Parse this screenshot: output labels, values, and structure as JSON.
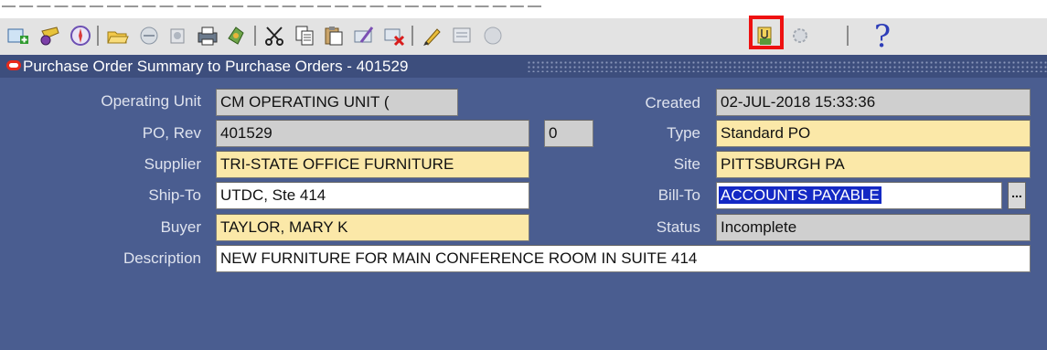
{
  "top_strip_text": "— — — — — — — — — — — — — — — — — — — — — — — — — — — — — — —",
  "toolbar": {
    "buttons": [
      {
        "name": "new-record-icon"
      },
      {
        "name": "find-icon"
      },
      {
        "name": "navigator-icon"
      },
      {
        "name": "open-folder-icon"
      },
      {
        "name": "save-icon"
      },
      {
        "name": "next-step-icon"
      },
      {
        "name": "print-icon"
      },
      {
        "name": "close-form-icon"
      },
      {
        "name": "cut-icon"
      },
      {
        "name": "copy-icon"
      },
      {
        "name": "paste-icon"
      },
      {
        "name": "clear-record-icon"
      },
      {
        "name": "delete-record-icon"
      },
      {
        "name": "edit-field-icon"
      },
      {
        "name": "zoom-icon"
      },
      {
        "name": "translations-icon"
      },
      {
        "name": "attachments-icon"
      },
      {
        "name": "folder-tools-icon"
      }
    ],
    "help_label": "?"
  },
  "window": {
    "title": "Purchase Order Summary to Purchase Orders - 401529"
  },
  "form": {
    "operating_unit_label": "Operating Unit",
    "operating_unit_value": "CM OPERATING UNIT (",
    "created_label": "Created",
    "created_value": "02-JUL-2018 15:33:36",
    "po_rev_label": "PO, Rev",
    "po_value": "401529",
    "rev_value": "0",
    "type_label": "Type",
    "type_value": "Standard PO",
    "supplier_label": "Supplier",
    "supplier_value": "TRI-STATE OFFICE FURNITURE",
    "site_label": "Site",
    "site_value": "PITTSBURGH PA",
    "ship_to_label": "Ship-To",
    "ship_to_value": "UTDC, Ste 414",
    "bill_to_label": "Bill-To",
    "bill_to_value": "ACCOUNTS PAYABLE",
    "bill_to_lov": "...",
    "buyer_label": "Buyer",
    "buyer_value": "TAYLOR, MARY K",
    "status_label": "Status",
    "status_value": "Incomplete",
    "description_label": "Description",
    "description_value": "NEW FURNITURE FOR MAIN CONFERENCE ROOM IN SUITE 414"
  },
  "colors": {
    "required_field": "#fbe8a8",
    "readonly_field": "#cfcfcf",
    "window_bg": "#4a5d90",
    "highlight": "#ee1111",
    "selection": "#1429c4"
  }
}
